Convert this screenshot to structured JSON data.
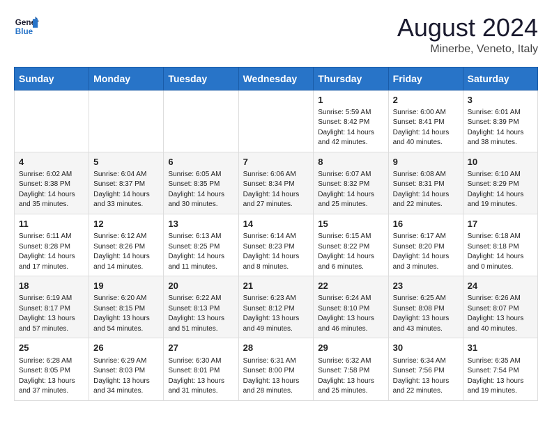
{
  "header": {
    "logo_line1": "General",
    "logo_line2": "Blue",
    "month_year": "August 2024",
    "location": "Minerbe, Veneto, Italy"
  },
  "days_of_week": [
    "Sunday",
    "Monday",
    "Tuesday",
    "Wednesday",
    "Thursday",
    "Friday",
    "Saturday"
  ],
  "weeks": [
    [
      {
        "day": "",
        "info": ""
      },
      {
        "day": "",
        "info": ""
      },
      {
        "day": "",
        "info": ""
      },
      {
        "day": "",
        "info": ""
      },
      {
        "day": "1",
        "info": "Sunrise: 5:59 AM\nSunset: 8:42 PM\nDaylight: 14 hours and 42 minutes."
      },
      {
        "day": "2",
        "info": "Sunrise: 6:00 AM\nSunset: 8:41 PM\nDaylight: 14 hours and 40 minutes."
      },
      {
        "day": "3",
        "info": "Sunrise: 6:01 AM\nSunset: 8:39 PM\nDaylight: 14 hours and 38 minutes."
      }
    ],
    [
      {
        "day": "4",
        "info": "Sunrise: 6:02 AM\nSunset: 8:38 PM\nDaylight: 14 hours and 35 minutes."
      },
      {
        "day": "5",
        "info": "Sunrise: 6:04 AM\nSunset: 8:37 PM\nDaylight: 14 hours and 33 minutes."
      },
      {
        "day": "6",
        "info": "Sunrise: 6:05 AM\nSunset: 8:35 PM\nDaylight: 14 hours and 30 minutes."
      },
      {
        "day": "7",
        "info": "Sunrise: 6:06 AM\nSunset: 8:34 PM\nDaylight: 14 hours and 27 minutes."
      },
      {
        "day": "8",
        "info": "Sunrise: 6:07 AM\nSunset: 8:32 PM\nDaylight: 14 hours and 25 minutes."
      },
      {
        "day": "9",
        "info": "Sunrise: 6:08 AM\nSunset: 8:31 PM\nDaylight: 14 hours and 22 minutes."
      },
      {
        "day": "10",
        "info": "Sunrise: 6:10 AM\nSunset: 8:29 PM\nDaylight: 14 hours and 19 minutes."
      }
    ],
    [
      {
        "day": "11",
        "info": "Sunrise: 6:11 AM\nSunset: 8:28 PM\nDaylight: 14 hours and 17 minutes."
      },
      {
        "day": "12",
        "info": "Sunrise: 6:12 AM\nSunset: 8:26 PM\nDaylight: 14 hours and 14 minutes."
      },
      {
        "day": "13",
        "info": "Sunrise: 6:13 AM\nSunset: 8:25 PM\nDaylight: 14 hours and 11 minutes."
      },
      {
        "day": "14",
        "info": "Sunrise: 6:14 AM\nSunset: 8:23 PM\nDaylight: 14 hours and 8 minutes."
      },
      {
        "day": "15",
        "info": "Sunrise: 6:15 AM\nSunset: 8:22 PM\nDaylight: 14 hours and 6 minutes."
      },
      {
        "day": "16",
        "info": "Sunrise: 6:17 AM\nSunset: 8:20 PM\nDaylight: 14 hours and 3 minutes."
      },
      {
        "day": "17",
        "info": "Sunrise: 6:18 AM\nSunset: 8:18 PM\nDaylight: 14 hours and 0 minutes."
      }
    ],
    [
      {
        "day": "18",
        "info": "Sunrise: 6:19 AM\nSunset: 8:17 PM\nDaylight: 13 hours and 57 minutes."
      },
      {
        "day": "19",
        "info": "Sunrise: 6:20 AM\nSunset: 8:15 PM\nDaylight: 13 hours and 54 minutes."
      },
      {
        "day": "20",
        "info": "Sunrise: 6:22 AM\nSunset: 8:13 PM\nDaylight: 13 hours and 51 minutes."
      },
      {
        "day": "21",
        "info": "Sunrise: 6:23 AM\nSunset: 8:12 PM\nDaylight: 13 hours and 49 minutes."
      },
      {
        "day": "22",
        "info": "Sunrise: 6:24 AM\nSunset: 8:10 PM\nDaylight: 13 hours and 46 minutes."
      },
      {
        "day": "23",
        "info": "Sunrise: 6:25 AM\nSunset: 8:08 PM\nDaylight: 13 hours and 43 minutes."
      },
      {
        "day": "24",
        "info": "Sunrise: 6:26 AM\nSunset: 8:07 PM\nDaylight: 13 hours and 40 minutes."
      }
    ],
    [
      {
        "day": "25",
        "info": "Sunrise: 6:28 AM\nSunset: 8:05 PM\nDaylight: 13 hours and 37 minutes."
      },
      {
        "day": "26",
        "info": "Sunrise: 6:29 AM\nSunset: 8:03 PM\nDaylight: 13 hours and 34 minutes."
      },
      {
        "day": "27",
        "info": "Sunrise: 6:30 AM\nSunset: 8:01 PM\nDaylight: 13 hours and 31 minutes."
      },
      {
        "day": "28",
        "info": "Sunrise: 6:31 AM\nSunset: 8:00 PM\nDaylight: 13 hours and 28 minutes."
      },
      {
        "day": "29",
        "info": "Sunrise: 6:32 AM\nSunset: 7:58 PM\nDaylight: 13 hours and 25 minutes."
      },
      {
        "day": "30",
        "info": "Sunrise: 6:34 AM\nSunset: 7:56 PM\nDaylight: 13 hours and 22 minutes."
      },
      {
        "day": "31",
        "info": "Sunrise: 6:35 AM\nSunset: 7:54 PM\nDaylight: 13 hours and 19 minutes."
      }
    ]
  ]
}
